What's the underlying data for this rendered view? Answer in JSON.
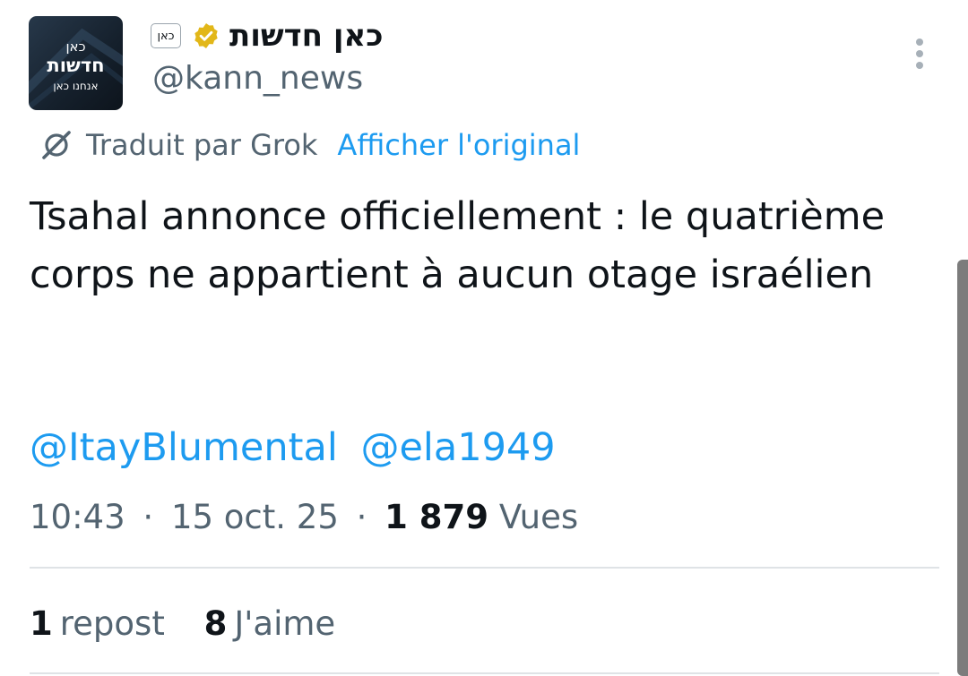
{
  "author": {
    "avatar_lines": [
      "כאן",
      "חדשות",
      "אנחנו כאן"
    ],
    "org_badge_text": "כאן",
    "display_name": "כאן חדשות",
    "handle": "@kann_news",
    "verified_color": "#e2b719"
  },
  "translation": {
    "label": "Traduit par Grok",
    "show_original": "Afficher l'original"
  },
  "tweet": {
    "text": "Tsahal annonce officiellement : le quatrième corps ne appartient à aucun otage israélien",
    "mentions": [
      "@ItayBlumental",
      "@ela1949"
    ]
  },
  "meta": {
    "time": "10:43",
    "separator": "·",
    "date": "15 oct. 25",
    "views_count": "1 879",
    "views_label": "Vues"
  },
  "stats": {
    "reposts_count": "1",
    "reposts_label": "repost",
    "likes_count": "8",
    "likes_label": "J'aime"
  },
  "colors": {
    "link": "#1d9bf0",
    "secondary_text": "#536471",
    "primary_text": "#0f1419"
  }
}
